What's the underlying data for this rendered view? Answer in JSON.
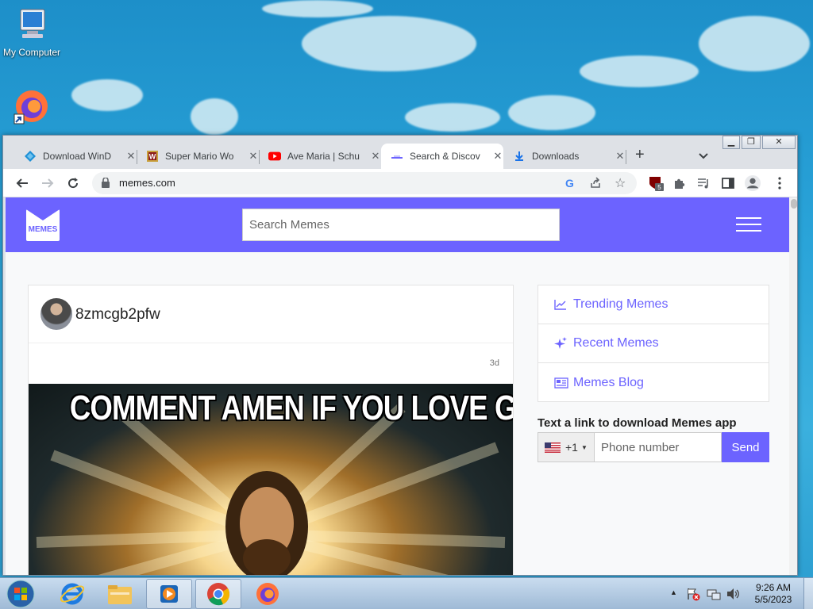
{
  "desktop": {
    "icons": [
      {
        "label": "My Computer",
        "icon": "computer-icon"
      },
      {
        "label": "",
        "icon": "firefox-shortcut-icon"
      }
    ]
  },
  "browser": {
    "tabs": [
      {
        "label": "Download WinD",
        "icon": "windows-diamond-icon",
        "active": false
      },
      {
        "label": "Super Mario Wo",
        "icon": "w-favicon-icon",
        "active": false
      },
      {
        "label": "Ave Maria | Schu",
        "icon": "youtube-icon",
        "active": false
      },
      {
        "label": "Search & Discov",
        "icon": "memes-favicon-icon",
        "active": true
      },
      {
        "label": "Downloads",
        "icon": "download-icon",
        "active": false
      }
    ],
    "new_tab_label": "+",
    "address": "memes.com",
    "extension_badge": "5"
  },
  "site": {
    "logo_text": "MEMES",
    "search_placeholder": "Search Memes",
    "accent": "#6c63ff",
    "post": {
      "username": "8zmcgb2pfw",
      "time": "3d",
      "caption": "COMMENT AMEN IF YOU LOVE GOD"
    },
    "sidebar": [
      {
        "label": "Trending Memes",
        "icon": "trending-chart-icon"
      },
      {
        "label": "Recent Memes",
        "icon": "sparkle-icon"
      },
      {
        "label": "Memes Blog",
        "icon": "newspaper-icon"
      }
    ],
    "sms": {
      "title": "Text a link to download Memes app",
      "country_code": "+1",
      "phone_placeholder": "Phone number",
      "send_label": "Send"
    }
  },
  "taskbar": {
    "time": "9:26 AM",
    "date": "5/5/2023"
  }
}
